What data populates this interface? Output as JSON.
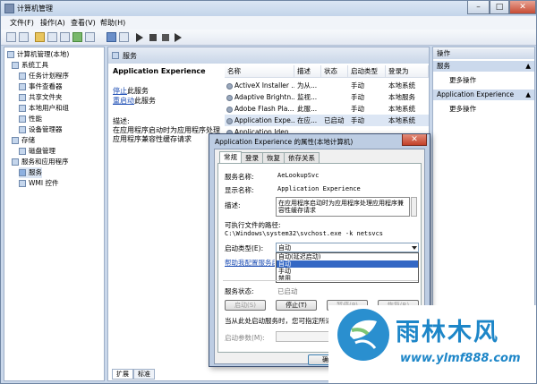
{
  "window": {
    "title": "计算机管理",
    "min": "–",
    "max": "□",
    "close": "✕"
  },
  "menus": [
    "文件(F)",
    "操作(A)",
    "查看(V)",
    "帮助(H)"
  ],
  "tree": {
    "root": "计算机管理(本地)",
    "system_tools": "系统工具",
    "task_scheduler": "任务计划程序",
    "event_viewer": "事件查看器",
    "shared_folders": "共享文件夹",
    "local_users": "本地用户和组",
    "performance": "性能",
    "device_manager": "设备管理器",
    "storage": "存储",
    "disk_management": "磁盘管理",
    "services_apps": "服务和应用程序",
    "services": "服务",
    "wmi": "WMI 控件"
  },
  "center": {
    "header": "服务",
    "detail": {
      "title": "Application Experience",
      "stop_link": "停止",
      "stop_suffix": "此服务",
      "restart_link": "重启动",
      "restart_suffix": "此服务",
      "desc_label": "描述:",
      "desc_text": "在应用程序启动时为应用程序处理应用程序兼容性缓存请求"
    },
    "columns": [
      "名称",
      "描述",
      "状态",
      "启动类型",
      "登录为"
    ],
    "rows": [
      {
        "name": "ActiveX Installer ...",
        "desc": "为从...",
        "status": "",
        "start": "手动",
        "logon": "本地系统"
      },
      {
        "name": "Adaptive Brightn...",
        "desc": "监视...",
        "status": "",
        "start": "手动",
        "logon": "本地服务"
      },
      {
        "name": "Adobe Flash Pla...",
        "desc": "此服...",
        "status": "",
        "start": "手动",
        "logon": "本地系统"
      },
      {
        "name": "Application Expe...",
        "desc": "在应...",
        "status": "已启动",
        "start": "手动",
        "logon": "本地系统"
      },
      {
        "name": "Application Iden...",
        "desc": "",
        "status": "",
        "start": "",
        "logon": ""
      }
    ],
    "tabs": [
      "扩展",
      "标准"
    ]
  },
  "actions": {
    "header": "操作",
    "section1": "服务",
    "more1": "更多操作",
    "section2": "Application Experience",
    "more2": "更多操作"
  },
  "dialog": {
    "title": "Application Experience 的属性(本地计算机)",
    "close": "✕",
    "tabs": [
      "常规",
      "登录",
      "恢复",
      "依存关系"
    ],
    "service_name_label": "服务名称:",
    "service_name": "AeLookupSvc",
    "display_name_label": "显示名称:",
    "display_name": "Application Experience",
    "desc_label": "描述:",
    "desc": "在应用程序启动时为应用程序处理应用程序兼容性缓存请求",
    "path_label": "可执行文件的路径:",
    "path": "C:\\Windows\\system32\\svchost.exe -k netsvcs",
    "startup_label": "启动类型(E):",
    "startup_value": "自动",
    "startup_options": [
      "自动(延迟启动)",
      "自动",
      "手动",
      "禁用"
    ],
    "help_link": "帮助我配置服务启动",
    "status_label": "服务状态:",
    "status_value": "已启动",
    "btn_start": "启动(S)",
    "btn_stop": "停止(T)",
    "btn_pause": "暂停(P)",
    "btn_resume": "恢复(R)",
    "hint": "当从此处启动服务时，您可指定所适用的启动参数。",
    "params_label": "启动参数(M):",
    "ok": "确定"
  },
  "watermark": {
    "name": "雨林木风",
    "url": "www.ylmf888.com"
  }
}
